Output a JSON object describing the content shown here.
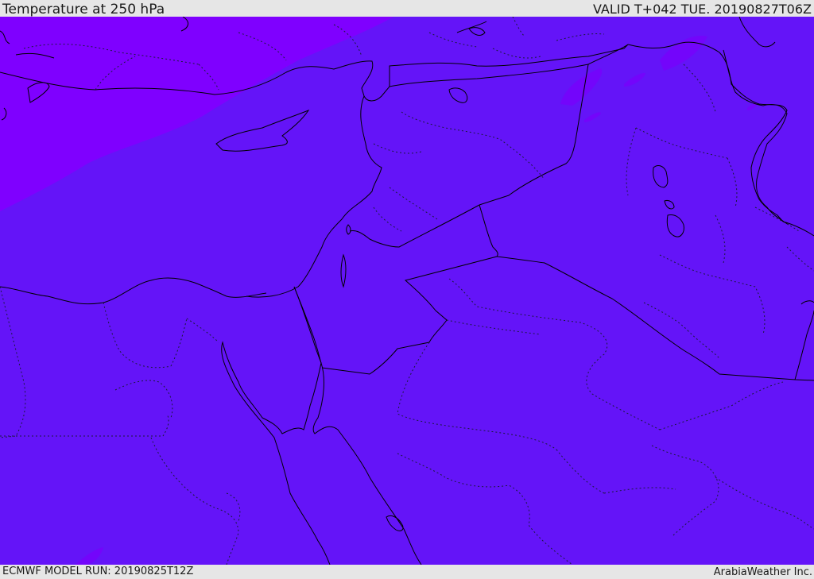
{
  "header": {
    "title": "Temperature at 250 hPa",
    "valid": "VALID T+042 TUE. 20190827T06Z"
  },
  "footer": {
    "model_run": "ECMWF MODEL RUN: 20190825T12Z",
    "credit": "ArabiaWeather Inc."
  },
  "map": {
    "field": "temperature",
    "level": "250 hPa",
    "colors": {
      "main_fill": "#6414f8",
      "cold_fill": "#7f00ff",
      "cold_patch": "#7305fb",
      "border_line": "#000000",
      "admin_line": "#1a1a3a"
    },
    "region_labels_visible": false
  }
}
